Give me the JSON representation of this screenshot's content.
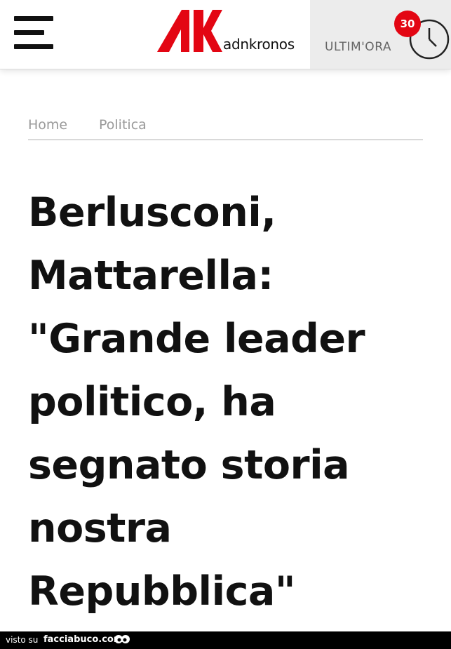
{
  "header": {
    "brand": "adnkronos",
    "ultimora_label": "ULTIM'ORA",
    "notification_count": "30",
    "accent_color": "#e30613"
  },
  "breadcrumb": {
    "items": [
      "Home",
      "Politica"
    ]
  },
  "article": {
    "headline": "Berlusconi, Mattarella: \"Grande leader politico, ha segnato storia nostra Repubblica\""
  },
  "footer": {
    "visto_su": "visto su",
    "site": "facciabuco.com"
  }
}
